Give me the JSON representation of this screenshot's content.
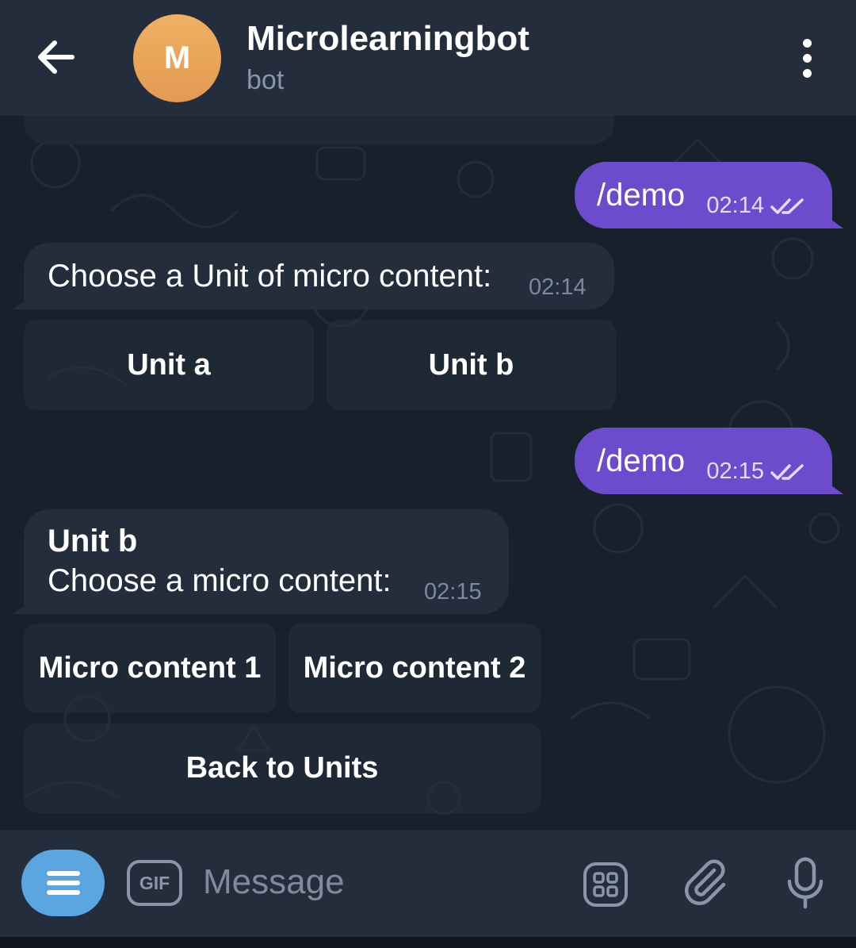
{
  "header": {
    "back_icon": "arrow-left-icon",
    "avatar_initial": "M",
    "title": "Microlearningbot",
    "subtitle": "bot",
    "menu_icon": "more-vertical-icon"
  },
  "messages": [
    {
      "direction": "out",
      "text": "/demo",
      "time": "02:14",
      "status_icon": "double-check-icon"
    },
    {
      "direction": "in",
      "text": "Choose a Unit of micro content:",
      "time": "02:14",
      "buttons": [
        "Unit a",
        "Unit b"
      ]
    },
    {
      "direction": "out",
      "text": "/demo",
      "time": "02:15",
      "status_icon": "double-check-icon"
    },
    {
      "direction": "in",
      "title": "Unit b",
      "text": "Choose a micro content:",
      "time": "02:15",
      "buttons": [
        "Micro content 1",
        "Micro content 2",
        "Back to Units"
      ]
    }
  ],
  "input_bar": {
    "menu_icon": "bot-menu-icon",
    "gif_label": "GIF",
    "placeholder": "Message",
    "sticker_icon": "sticker-icon",
    "attach_icon": "paperclip-icon",
    "mic_icon": "microphone-icon"
  },
  "colors": {
    "header_bg": "#232d3b",
    "chat_bg": "#18202b",
    "outgoing_bubble": "#6c4bcc",
    "incoming_bubble": "#232d3b",
    "accent": "#5ba5e0"
  }
}
